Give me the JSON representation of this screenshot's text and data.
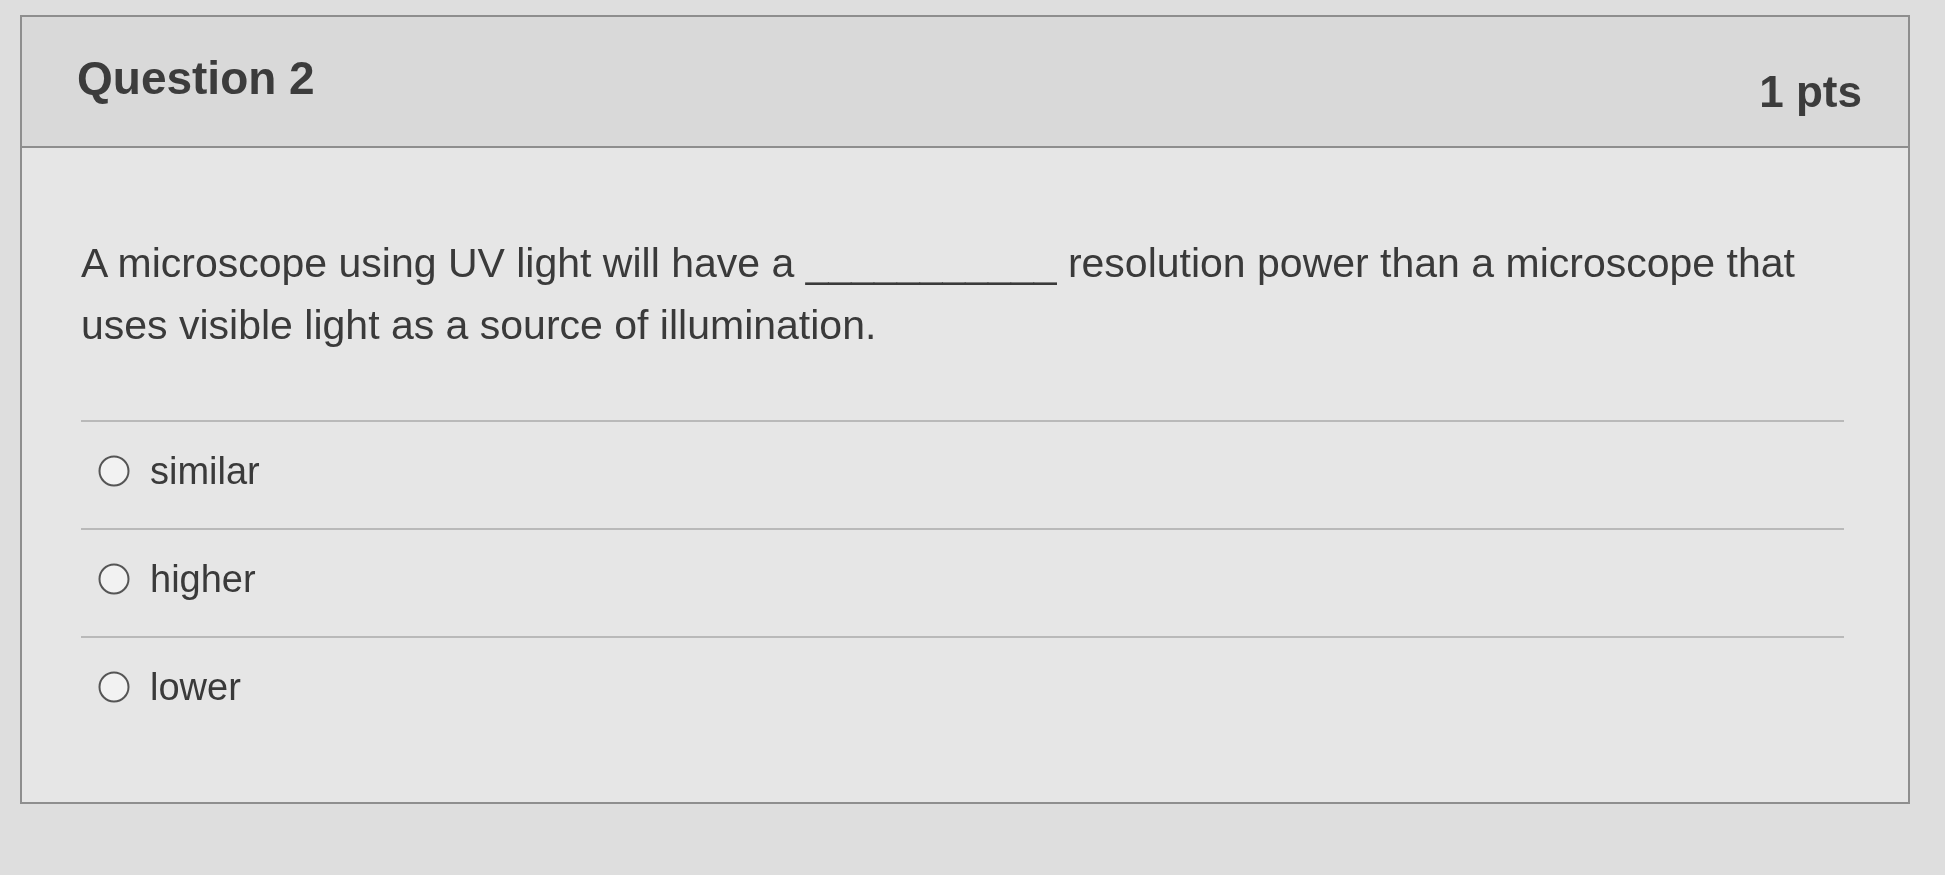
{
  "question": {
    "title": "Question 2",
    "points": "1 pts",
    "text": "A microscope using UV light will have a ___________ resolution power than a microscope that uses visible light as a source of illumination.",
    "answers": [
      {
        "label": "similar",
        "selected": false
      },
      {
        "label": "higher",
        "selected": false
      },
      {
        "label": "lower",
        "selected": false
      }
    ]
  }
}
